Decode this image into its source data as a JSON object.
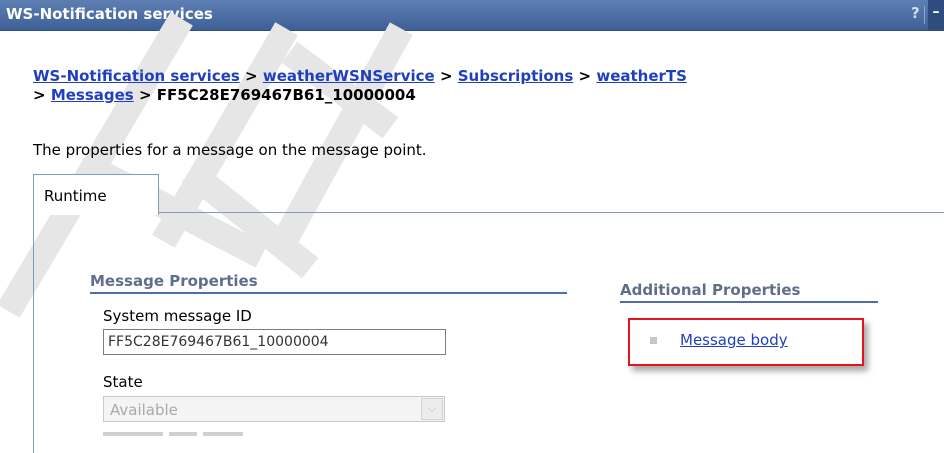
{
  "window": {
    "title": "WS-Notification services",
    "help_glyph": "?",
    "minimize_glyph": "–"
  },
  "breadcrumb": {
    "items": [
      "WS-Notification services",
      "weatherWSNService",
      "Subscriptions",
      "weatherTS",
      "Messages"
    ],
    "separator": ">",
    "current": "FF5C28E769467B61_10000004"
  },
  "description": "The properties for a message on the message point.",
  "tabs": [
    {
      "label": "Runtime",
      "selected": true
    }
  ],
  "message_properties": {
    "heading": "Message Properties",
    "system_message_id": {
      "label": "System message ID",
      "value": "FF5C28E769467B61_10000004"
    },
    "state": {
      "label": "State",
      "value": "Available",
      "disabled": true
    }
  },
  "additional_properties": {
    "heading": "Additional Properties",
    "links": [
      {
        "label": "Message body"
      }
    ]
  },
  "colors": {
    "titlebar": "#4a6ba3",
    "link": "#1f3fbf",
    "section_heading": "#5e6f8c",
    "callout_border": "#e4131d"
  }
}
